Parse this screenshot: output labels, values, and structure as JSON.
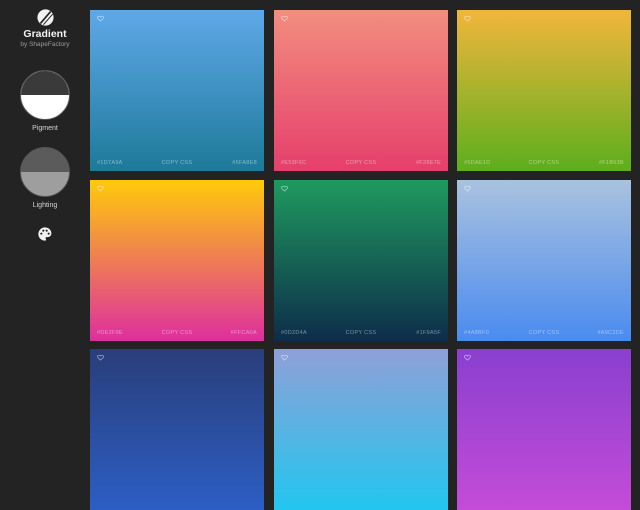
{
  "app": {
    "title": "Gradient",
    "subtitle": "by ShapeFactory"
  },
  "controls": {
    "pigment": {
      "label": "Pigment",
      "level": 0.5
    },
    "lighting": {
      "label": "Lighting",
      "level": 0.5
    },
    "palette_icon": "palette-icon"
  },
  "colors": {
    "background": "#232323",
    "text": "#f2f2f2",
    "muted": "#9a9a9a"
  },
  "cards": [
    {
      "hex_from": "#1D7A9A",
      "copy_label": "COPY CSS",
      "hex_to": "#5FA8E8",
      "color_top": "#5fa8e8",
      "color_bottom": "#1d7a9a"
    },
    {
      "hex_from": "#E53F6C",
      "copy_label": "COPY CSS",
      "hex_to": "#F28E7E",
      "color_top": "#f28e7e",
      "color_bottom": "#e53f6c"
    },
    {
      "hex_from": "#5DAE1D",
      "copy_label": "COPY CSS",
      "hex_to": "#F1B63B",
      "color_top": "#f1b63b",
      "color_bottom": "#5dae1d"
    },
    {
      "hex_from": "#DE2F9E",
      "copy_label": "COPY CSS",
      "hex_to": "#FFCA0A",
      "color_top": "#ffca0a",
      "color_bottom": "#de2f9e"
    },
    {
      "hex_from": "#0D2D4A",
      "copy_label": "COPY CSS",
      "hex_to": "#1F9A5F",
      "color_top": "#1f9a5f",
      "color_bottom": "#0d2d4a"
    },
    {
      "hex_from": "#4A8BF0",
      "copy_label": "COPY CSS",
      "hex_to": "#A9C2DE",
      "color_top": "#a9c2de",
      "color_bottom": "#4a8bf0"
    },
    {
      "hex_from": "",
      "copy_label": "",
      "hex_to": "",
      "color_top": "#2a3e7a",
      "color_bottom": "#2c5ec4"
    },
    {
      "hex_from": "",
      "copy_label": "",
      "hex_to": "",
      "color_top": "#8fa0d8",
      "color_bottom": "#22c6ee"
    },
    {
      "hex_from": "",
      "copy_label": "",
      "hex_to": "",
      "color_top": "#8a3fd0",
      "color_bottom": "#c44cd8"
    }
  ]
}
